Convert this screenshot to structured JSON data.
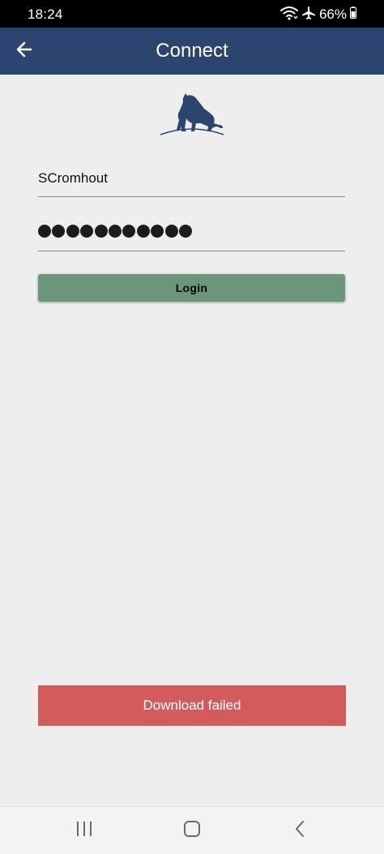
{
  "status_bar": {
    "time": "18:24",
    "battery_percent": "66%",
    "icons": [
      "wifi-icon",
      "airplane-icon",
      "battery-icon"
    ]
  },
  "app_bar": {
    "title": "Connect",
    "back_icon": "arrow-left-icon",
    "background": "#2c4470"
  },
  "login_form": {
    "username_value": "SCromhout",
    "password_mask_count": 11,
    "login_label": "Login",
    "login_color": "#6b967a"
  },
  "toast": {
    "message": "Download failed",
    "color": "#d45b5b"
  },
  "nav_bar": {
    "buttons": [
      "recents-icon",
      "home-icon",
      "back-icon"
    ]
  }
}
